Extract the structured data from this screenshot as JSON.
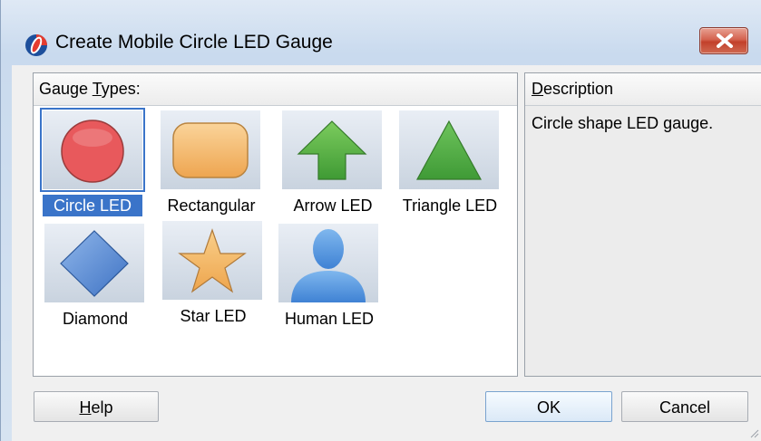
{
  "window": {
    "title": "Create Mobile Circle LED Gauge",
    "app_icon": "oracle-jdev-icon",
    "close_icon": "close-x-icon"
  },
  "gauge_types": {
    "header_prefix": "Gauge ",
    "header_mnemonic": "T",
    "header_suffix": "ypes:",
    "selected": "Circle LED",
    "items": [
      {
        "label": "Circle LED",
        "icon": "circle-icon",
        "color": "#e8595c"
      },
      {
        "label": "Rectangular",
        "icon": "rounded-rectangle-icon",
        "color": "#f4b868"
      },
      {
        "label": "Arrow LED",
        "icon": "arrow-up-icon",
        "color": "#5cb446"
      },
      {
        "label": "Triangle LED",
        "icon": "triangle-icon",
        "color": "#52b44a"
      },
      {
        "label": "Diamond",
        "icon": "diamond-icon",
        "color": "#5a8fd6"
      },
      {
        "label": "Star LED",
        "icon": "star-icon",
        "color": "#f2b45c"
      },
      {
        "label": "Human LED",
        "icon": "person-icon",
        "color": "#5f9fe0"
      }
    ]
  },
  "description": {
    "header_mnemonic": "D",
    "header_suffix": "escription",
    "text": "Circle shape LED gauge."
  },
  "buttons": {
    "help_mnemonic": "H",
    "help_suffix": "elp",
    "ok": "OK",
    "cancel": "Cancel"
  },
  "colors": {
    "selection": "#3a74c9",
    "close_button": "#c9442f"
  }
}
